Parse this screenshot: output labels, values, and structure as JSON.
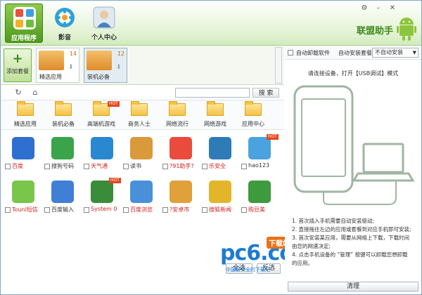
{
  "header": {
    "nav": [
      {
        "label": "应用程序",
        "icon": "apps-grid-icon",
        "active": true
      },
      {
        "label": "影音",
        "icon": "media-film-icon",
        "active": false
      },
      {
        "label": "个人中心",
        "icon": "user-center-icon",
        "active": false
      }
    ],
    "brand": "联盟助手",
    "window_buttons": [
      "settings-icon",
      "minimize-icon",
      "close-icon"
    ]
  },
  "packages": {
    "add_label": "添加套餐",
    "items": [
      {
        "name": "精选应用",
        "count": "14"
      },
      {
        "name": "装机必备",
        "count": "12"
      }
    ]
  },
  "toolbar": {
    "search_placeholder": "",
    "search_label": "搜 索"
  },
  "categories": [
    {
      "label": "精选应用",
      "hot": false
    },
    {
      "label": "装机必备",
      "hot": false
    },
    {
      "label": "高端机游戏",
      "hot": true
    },
    {
      "label": "商务人士",
      "hot": false
    },
    {
      "label": "网络流行",
      "hot": false
    },
    {
      "label": "网络游戏",
      "hot": false
    },
    {
      "label": "应用中心",
      "hot": false
    }
  ],
  "apps": [
    {
      "name": "百度",
      "color": "#2f6fd0",
      "red": true,
      "hot": false
    },
    {
      "name": "搜狗号码",
      "color": "#3aa44a",
      "red": false,
      "hot": false
    },
    {
      "name": "天气通",
      "color": "#2a88d0",
      "red": true,
      "hot": false
    },
    {
      "name": "读书",
      "color": "#d89a3a",
      "red": false,
      "hot": false
    },
    {
      "name": "?91助手?",
      "color": "#e94b3c",
      "red": true,
      "hot": false
    },
    {
      "name": "乐安全",
      "color": "#2e7bb8",
      "red": true,
      "hot": false
    },
    {
      "name": "hao123",
      "color": "#4aa3df",
      "red": false,
      "hot": true
    },
    {
      "name": "Touni短信",
      "color": "#79c64a",
      "red": true,
      "hot": false
    },
    {
      "name": "百度输入",
      "color": "#3f7fd6",
      "red": false,
      "hot": false
    },
    {
      "name": "System 0",
      "color": "#3a8c3a",
      "red": true,
      "hot": true
    },
    {
      "name": "百度浏览",
      "color": "#4a90d9",
      "red": true,
      "hot": false
    },
    {
      "name": "?安卓市",
      "color": "#e0a03a",
      "red": true,
      "hot": false
    },
    {
      "name": "搜狐新闻",
      "color": "#e2b52a",
      "red": true,
      "hot": false
    },
    {
      "name": "购豆美",
      "color": "#3d9a3d",
      "red": true,
      "hot": false
    }
  ],
  "hot_badge": "HOT",
  "buttons": {
    "select_all": "全选",
    "invert": "反选"
  },
  "right": {
    "auto_uninstall": "自动卸载软件",
    "auto_install_label": "自动安装套餐:",
    "auto_install_value": "不自动安装",
    "connect_msg": "请连接设备，打开【USB调试】模式",
    "steps": [
      "1. 首次插入手机需要自动安装驱动;",
      "2. 直接拖往左边的应用或套餐到对应手机即可安装;",
      "3. 首次安装某应用，需要从网络上下载，下载时间",
      "   由您的网速决定;",
      "4. 点击手机设备的 “管理” 按键可以卸载您想卸载",
      "   的应用。"
    ],
    "clean_label": "清理"
  },
  "watermark": {
    "logo": "pc6.com",
    "badge": "下载站",
    "sub": "中国最安全的下载站"
  }
}
